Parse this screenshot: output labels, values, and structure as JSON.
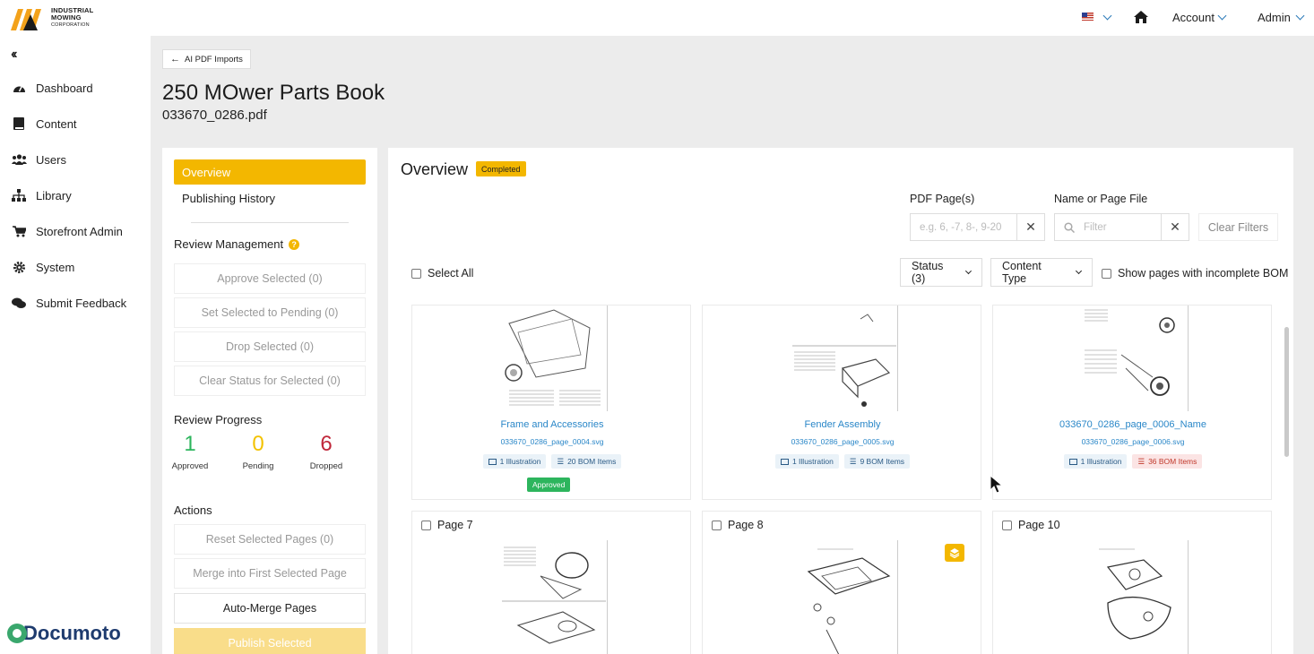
{
  "header": {
    "logo_line1": "INDUSTRIAL",
    "logo_line2": "MOWING",
    "logo_line3": "CORPORATION",
    "account_label": "Account",
    "admin_label": "Admin"
  },
  "sidebar": {
    "items": [
      {
        "label": "Dashboard",
        "icon": "dashboard-icon"
      },
      {
        "label": "Content",
        "icon": "book-icon"
      },
      {
        "label": "Users",
        "icon": "users-icon"
      },
      {
        "label": "Library",
        "icon": "sitemap-icon"
      },
      {
        "label": "Storefront Admin",
        "icon": "cart-icon"
      },
      {
        "label": "System",
        "icon": "gear-icon"
      },
      {
        "label": "Submit Feedback",
        "icon": "comments-icon"
      }
    ],
    "brand": "Documoto"
  },
  "page": {
    "back_label": "AI PDF Imports",
    "title": "250 MOwer Parts Book",
    "file": "033670_0286.pdf"
  },
  "left_panel": {
    "menu": {
      "active": "Overview",
      "history": "Publishing History"
    },
    "review_management": {
      "title": "Review Management",
      "approve": "Approve Selected (0)",
      "pending": "Set Selected to Pending (0)",
      "drop": "Drop Selected (0)",
      "clear": "Clear Status for Selected (0)"
    },
    "review_progress": {
      "title": "Review Progress",
      "approved": {
        "value": "1",
        "label": "Approved",
        "color": "#2db55d"
      },
      "pending": {
        "value": "0",
        "label": "Pending",
        "color": "#f3c200"
      },
      "dropped": {
        "value": "6",
        "label": "Dropped",
        "color": "#c0273a"
      }
    },
    "actions": {
      "title": "Actions",
      "reset": "Reset Selected Pages (0)",
      "merge": "Merge into First Selected Page",
      "auto_merge": "Auto-Merge Pages",
      "publish": "Publish Selected"
    }
  },
  "overview": {
    "title": "Overview",
    "status": "Completed",
    "filters": {
      "pdf_pages_label": "PDF Page(s)",
      "pdf_pages_placeholder": "e.g. 6, -7, 8-, 9-20",
      "name_label": "Name or Page File",
      "name_placeholder": "Filter",
      "clear_label": "Clear Filters"
    },
    "select_all": "Select All",
    "status_dropdown": "Status (3)",
    "content_type_dropdown": "Content Type",
    "incomplete_bom": "Show pages with incomplete BOM",
    "cards": [
      {
        "title": "Frame and Accessories",
        "file": "033670_0286_page_0004.svg",
        "illustration": "1 Illustration",
        "bom": "20 BOM Items",
        "bom_warning": false,
        "status": "Approved"
      },
      {
        "title": "Fender Assembly",
        "file": "033670_0286_page_0005.svg",
        "illustration": "1 Illustration",
        "bom": "9 BOM Items",
        "bom_warning": false
      },
      {
        "title": "033670_0286_page_0006_Name",
        "file": "033670_0286_page_0006.svg",
        "illustration": "1 Illustration",
        "bom": "36 BOM Items",
        "bom_warning": true
      }
    ],
    "page_cards": [
      {
        "label": "Page 7"
      },
      {
        "label": "Page 8",
        "icon": "layers-icon"
      },
      {
        "label": "Page 10"
      }
    ]
  }
}
